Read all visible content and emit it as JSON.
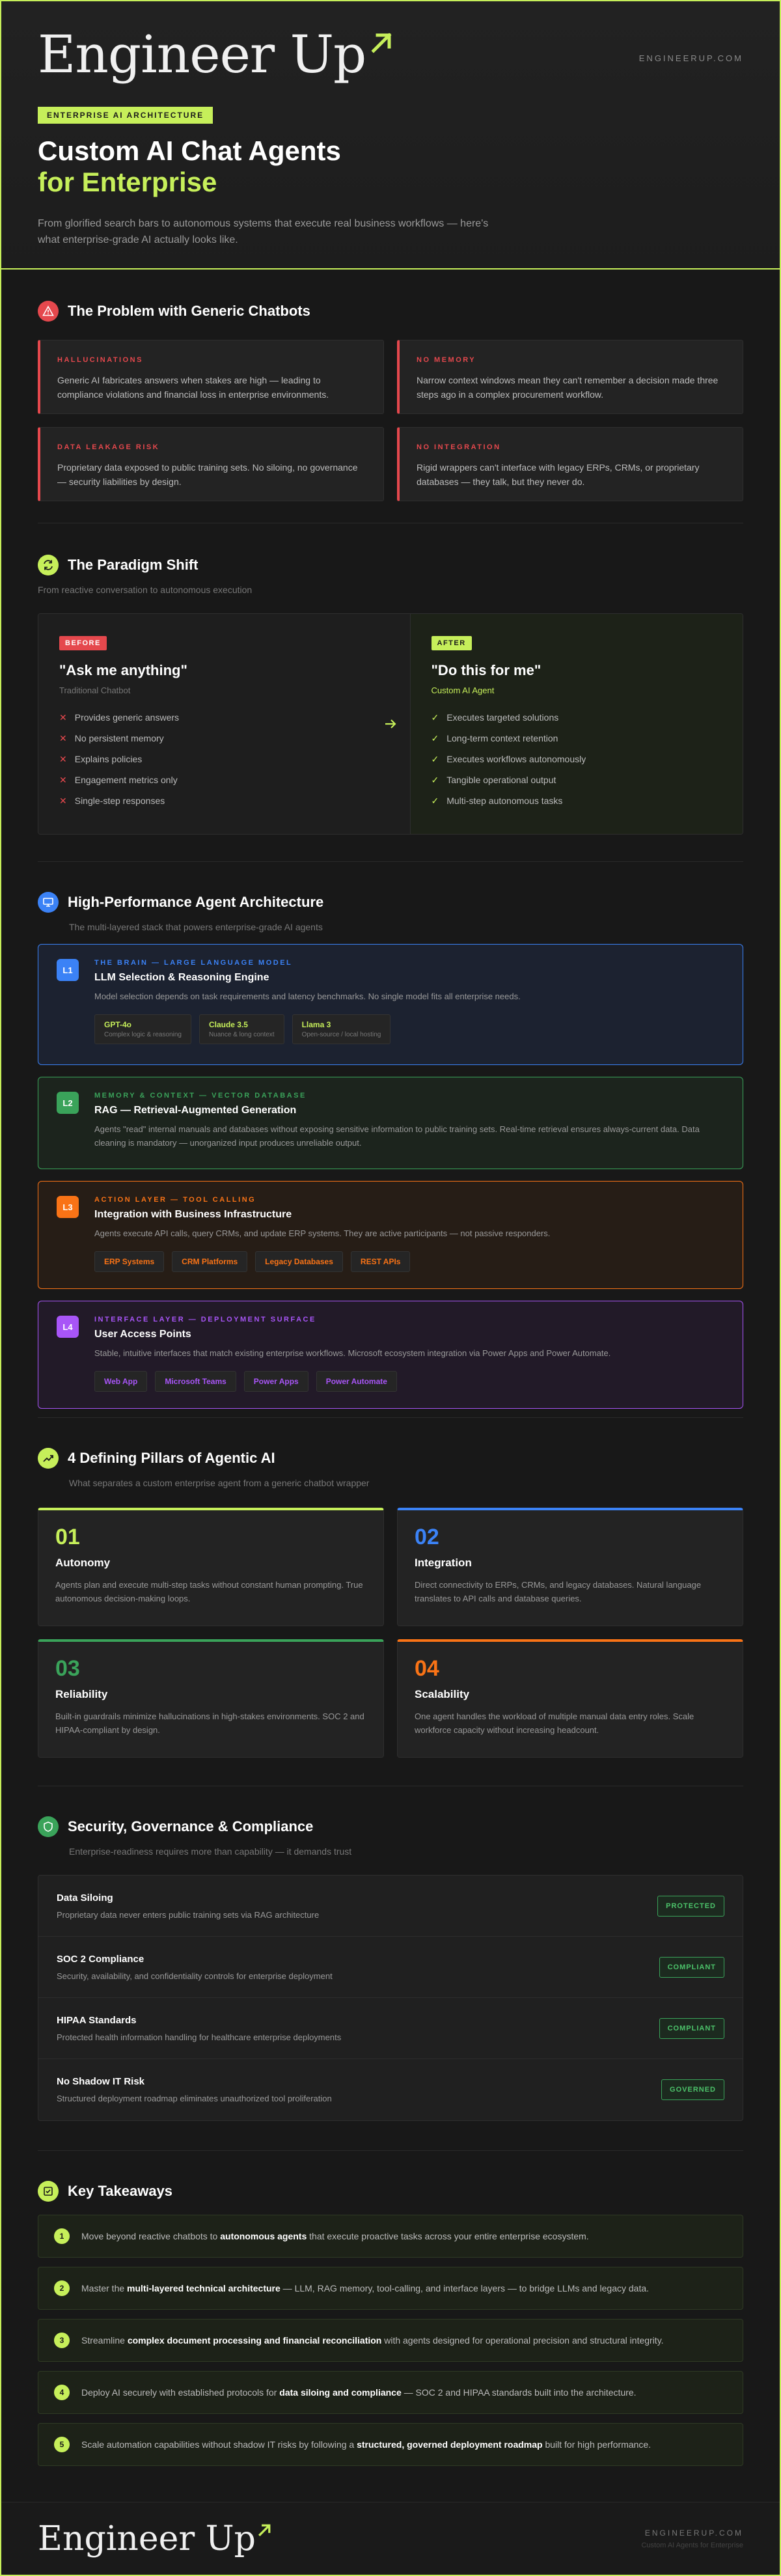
{
  "hero": {
    "logo": "Engineer Up",
    "site": "ENGINEERUP.COM",
    "tag": "ENTERPRISE AI ARCHITECTURE",
    "title1": "Custom AI Chat Agents",
    "title2": "for Enterprise",
    "lead": "From glorified search bars to autonomous systems that execute real business workflows — here's what enterprise-grade AI actually looks like."
  },
  "problem": {
    "title": "The Problem with Generic Chatbots",
    "cards": [
      {
        "k": "HALLUCINATIONS",
        "t": "Generic AI fabricates answers when stakes are high — leading to compliance violations and financial loss in enterprise environments."
      },
      {
        "k": "NO MEMORY",
        "t": "Narrow context windows mean they can't remember a decision made three steps ago in a complex procurement workflow."
      },
      {
        "k": "DATA LEAKAGE RISK",
        "t": "Proprietary data exposed to public training sets. No siloing, no governance — security liabilities by design."
      },
      {
        "k": "NO INTEGRATION",
        "t": "Rigid wrappers can't interface with legacy ERPs, CRMs, or proprietary databases — they talk, but they never do."
      }
    ]
  },
  "shift": {
    "title": "The Paradigm Shift",
    "sub": "From reactive conversation to autonomous execution",
    "before": {
      "pill": "BEFORE",
      "quote": "\"Ask me anything\"",
      "sub": "Traditional Chatbot",
      "items": [
        "Provides generic answers",
        "No persistent memory",
        "Explains policies",
        "Engagement metrics only",
        "Single-step responses"
      ]
    },
    "after": {
      "pill": "AFTER",
      "quote": "\"Do this for me\"",
      "sub": "Custom AI Agent",
      "items": [
        "Executes targeted solutions",
        "Long-term context retention",
        "Executes workflows autonomously",
        "Tangible operational output",
        "Multi-step autonomous tasks"
      ]
    }
  },
  "arch": {
    "title": "High-Performance Agent Architecture",
    "sub": "The multi-layered stack that powers enterprise-grade AI agents",
    "layers": [
      {
        "num": "L1",
        "k": "THE BRAIN — LARGE LANGUAGE MODEL",
        "t": "LLM Selection & Reasoning Engine",
        "d": "Model selection depends on task requirements and latency benchmarks. No single model fits all enterprise needs.",
        "chips": [
          {
            "n": "GPT-4o",
            "s": "Complex logic & reasoning"
          },
          {
            "n": "Claude 3.5",
            "s": "Nuance & long context"
          },
          {
            "n": "Llama 3",
            "s": "Open-source / local hosting"
          }
        ]
      },
      {
        "num": "L2",
        "k": "MEMORY & CONTEXT — VECTOR DATABASE",
        "t": "RAG — Retrieval-Augmented Generation",
        "d": "Agents \"read\" internal manuals and databases without exposing sensitive information to public training sets. Real-time retrieval ensures always-current data. Data cleaning is mandatory — unorganized input produces unreliable output.",
        "chips": []
      },
      {
        "num": "L3",
        "k": "ACTION LAYER — TOOL CALLING",
        "t": "Integration with Business Infrastructure",
        "d": "Agents execute API calls, query CRMs, and update ERP systems. They are active participants — not passive responders.",
        "chips": [
          {
            "n": "ERP Systems",
            "s": ""
          },
          {
            "n": "CRM Platforms",
            "s": ""
          },
          {
            "n": "Legacy Databases",
            "s": ""
          },
          {
            "n": "REST APIs",
            "s": ""
          }
        ]
      },
      {
        "num": "L4",
        "k": "INTERFACE LAYER — DEPLOYMENT SURFACE",
        "t": "User Access Points",
        "d": "Stable, intuitive interfaces that match existing enterprise workflows. Microsoft ecosystem integration via Power Apps and Power Automate.",
        "chips": [
          {
            "n": "Web App",
            "s": ""
          },
          {
            "n": "Microsoft Teams",
            "s": ""
          },
          {
            "n": "Power Apps",
            "s": ""
          },
          {
            "n": "Power Automate",
            "s": ""
          }
        ]
      }
    ]
  },
  "pillars": {
    "title": "4 Defining Pillars of Agentic AI",
    "sub": "What separates a custom enterprise agent from a generic chatbot wrapper",
    "items": [
      {
        "n": "01",
        "t": "Autonomy",
        "d": "Agents plan and execute multi-step tasks without constant human prompting. True autonomous decision-making loops."
      },
      {
        "n": "02",
        "t": "Integration",
        "d": "Direct connectivity to ERPs, CRMs, and legacy databases. Natural language translates to API calls and database queries."
      },
      {
        "n": "03",
        "t": "Reliability",
        "d": "Built-in guardrails minimize hallucinations in high-stakes environments. SOC 2 and HIPAA-compliant by design."
      },
      {
        "n": "04",
        "t": "Scalability",
        "d": "One agent handles the workload of multiple manual data entry roles. Scale workforce capacity without increasing headcount."
      }
    ]
  },
  "security": {
    "title": "Security, Governance & Compliance",
    "sub": "Enterprise-readiness requires more than capability — it demands trust",
    "rows": [
      {
        "t": "Data Siloing",
        "d": "Proprietary data never enters public training sets via RAG architecture",
        "s": "PROTECTED"
      },
      {
        "t": "SOC 2 Compliance",
        "d": "Security, availability, and confidentiality controls for enterprise deployment",
        "s": "COMPLIANT"
      },
      {
        "t": "HIPAA Standards",
        "d": "Protected health information handling for healthcare enterprise deployments",
        "s": "COMPLIANT"
      },
      {
        "t": "No Shadow IT Risk",
        "d": "Structured deployment roadmap eliminates unauthorized tool proliferation",
        "s": "GOVERNED"
      }
    ]
  },
  "takeaways": {
    "title": "Key Takeaways",
    "items": [
      {
        "n": "1",
        "a": "Move beyond reactive chatbots to ",
        "b": "autonomous agents",
        "c": " that execute proactive tasks across your entire enterprise ecosystem."
      },
      {
        "n": "2",
        "a": "Master the ",
        "b": "multi-layered technical architecture",
        "c": " — LLM, RAG memory, tool-calling, and interface layers — to bridge LLMs and legacy data."
      },
      {
        "n": "3",
        "a": "Streamline ",
        "b": "complex document processing and financial reconciliation",
        "c": " with agents designed for operational precision and structural integrity."
      },
      {
        "n": "4",
        "a": "Deploy AI securely with established protocols for ",
        "b": "data siloing and compliance",
        "c": " — SOC 2 and HIPAA standards built into the architecture."
      },
      {
        "n": "5",
        "a": "Scale automation capabilities without shadow IT risks by following a ",
        "b": "structured, governed deployment roadmap",
        "c": " built for high performance."
      }
    ]
  },
  "footer": {
    "logo": "Engineer Up",
    "site": "ENGINEERUP.COM",
    "sub": "Custom AI Agents for Enterprise"
  },
  "colors": {
    "accent": "#c6ef5a",
    "red": "#e5484d",
    "blue": "#3b82f6",
    "green": "#3aa35a",
    "orange": "#f97316",
    "purple": "#a855f7"
  }
}
